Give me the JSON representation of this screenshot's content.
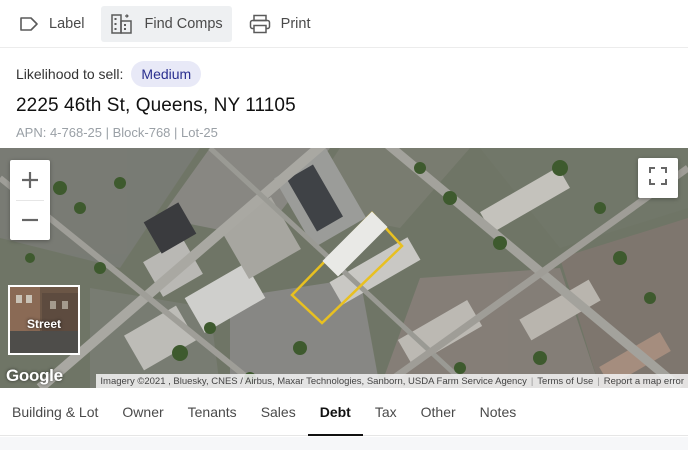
{
  "toolbar": {
    "label_btn": {
      "label": "Label",
      "icon": "tag-icon"
    },
    "find_comps_btn": {
      "label": "Find Comps",
      "icon": "buildings-icon"
    },
    "print_btn": {
      "label": "Print",
      "icon": "printer-icon"
    }
  },
  "property": {
    "likelihood_label": "Likelihood to sell:",
    "likelihood_value": "Medium",
    "address": "2225 46th St, Queens, NY 11105",
    "apn_line": "APN: 4-768-25 | Block-768 | Lot-25"
  },
  "map": {
    "zoom_in": "+",
    "zoom_out": "−",
    "street_label": "Street",
    "google_logo": "Google",
    "attribution": "Imagery ©2021 , Bluesky, CNES / Airbus, Maxar Technologies, Sanborn, USDA Farm Service Agency",
    "terms": "Terms of Use",
    "report": "Report a map error",
    "highlight_color": "#e8c021"
  },
  "tabs": {
    "items": [
      "Building & Lot",
      "Owner",
      "Tenants",
      "Sales",
      "Debt",
      "Tax",
      "Other",
      "Notes"
    ],
    "active": "Debt"
  }
}
